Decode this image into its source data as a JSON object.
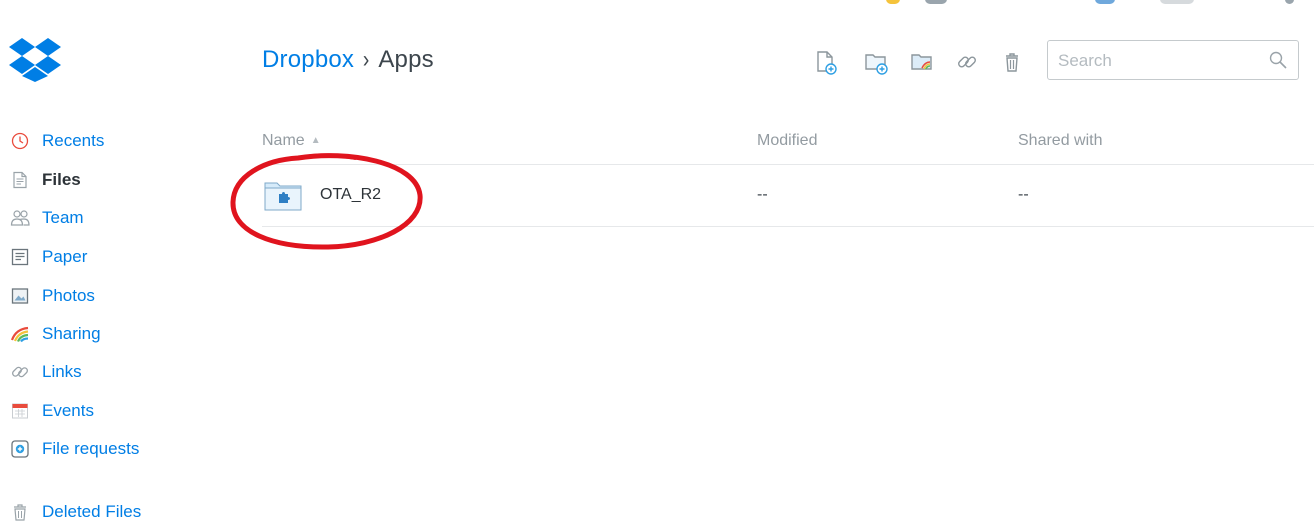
{
  "brand": {
    "logo_icon": "dropbox-logo-icon",
    "accent": "#007ee5"
  },
  "breadcrumb": {
    "root": "Dropbox",
    "separator": "›",
    "current": "Apps"
  },
  "toolbar": {
    "buttons": [
      {
        "icon": "upload-file-icon"
      },
      {
        "icon": "new-folder-icon"
      },
      {
        "icon": "new-shared-folder-icon"
      },
      {
        "icon": "link-icon"
      },
      {
        "icon": "trash-icon"
      }
    ]
  },
  "search": {
    "placeholder": "Search",
    "value": "",
    "icon": "search-icon"
  },
  "sidebar": {
    "items": [
      {
        "label": "Recents",
        "icon": "clock-icon",
        "active": false
      },
      {
        "label": "Files",
        "icon": "file-icon",
        "active": true
      },
      {
        "label": "Team",
        "icon": "team-icon",
        "active": false
      },
      {
        "label": "Paper",
        "icon": "paper-icon",
        "active": false
      },
      {
        "label": "Photos",
        "icon": "photo-icon",
        "active": false
      },
      {
        "label": "Sharing",
        "icon": "rainbow-icon",
        "active": false
      },
      {
        "label": "Links",
        "icon": "link-icon",
        "active": false
      },
      {
        "label": "Events",
        "icon": "calendar-icon",
        "active": false
      },
      {
        "label": "File requests",
        "icon": "file-request-icon",
        "active": false
      },
      {
        "label": "Deleted Files",
        "icon": "trash-icon",
        "active": false
      }
    ]
  },
  "table": {
    "columns": {
      "name": "Name",
      "sort_indicator": "▲",
      "modified": "Modified",
      "shared_with": "Shared with"
    },
    "rows": [
      {
        "name": "OTA_R2",
        "icon": "app-folder-icon",
        "modified": "--",
        "shared_with": "--"
      }
    ]
  },
  "annotation": {
    "shape": "ellipse",
    "color": "#e0141e"
  }
}
